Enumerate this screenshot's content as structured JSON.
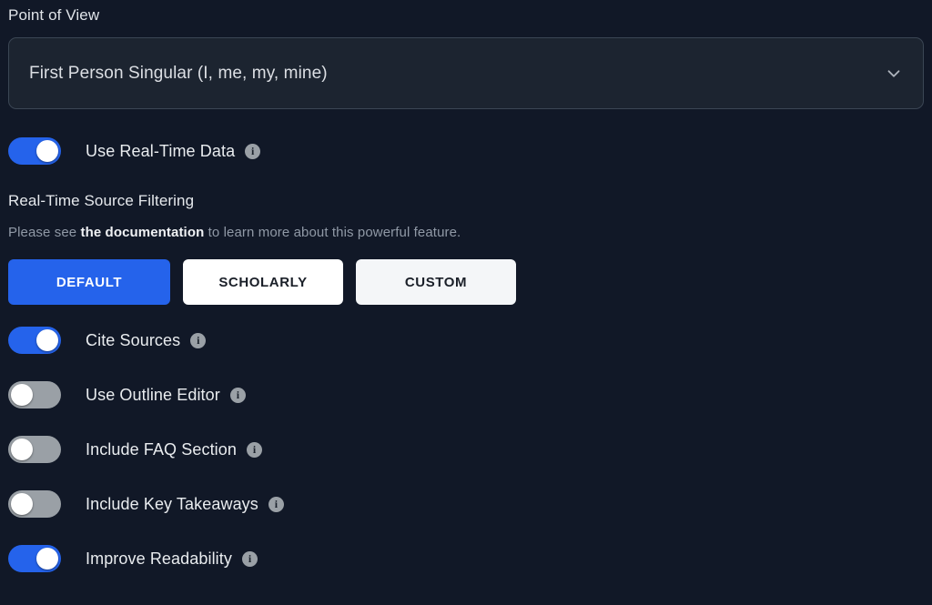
{
  "point_of_view": {
    "label": "Point of View",
    "selected_value": "First Person Singular (I, me, my, mine)",
    "chevron": "chevron-down-icon"
  },
  "real_time_data_toggle": {
    "label": "Use Real-Time Data",
    "state": "on",
    "info": "i"
  },
  "source_filtering": {
    "title": "Real-Time Source Filtering",
    "desc_before": "Please see ",
    "desc_link": "the documentation",
    "desc_after": " to learn more about this powerful feature.",
    "buttons": [
      {
        "label": "DEFAULT",
        "selected": true
      },
      {
        "label": "SCHOLARLY",
        "selected": false
      },
      {
        "label": "CUSTOM",
        "selected": false
      }
    ]
  },
  "options": [
    {
      "label": "Cite Sources",
      "state": "on",
      "info": "i"
    },
    {
      "label": "Use Outline Editor",
      "state": "off",
      "info": "i"
    },
    {
      "label": "Include FAQ Section",
      "state": "off",
      "info": "i"
    },
    {
      "label": "Include Key Takeaways",
      "state": "off",
      "info": "i"
    },
    {
      "label": "Improve Readability",
      "state": "on",
      "info": "i"
    }
  ],
  "colors": {
    "background": "#111827",
    "accent": "#2563eb",
    "toggle_off": "#9aa0a6",
    "field_bg": "#1c2430",
    "field_border": "#3b4654"
  }
}
